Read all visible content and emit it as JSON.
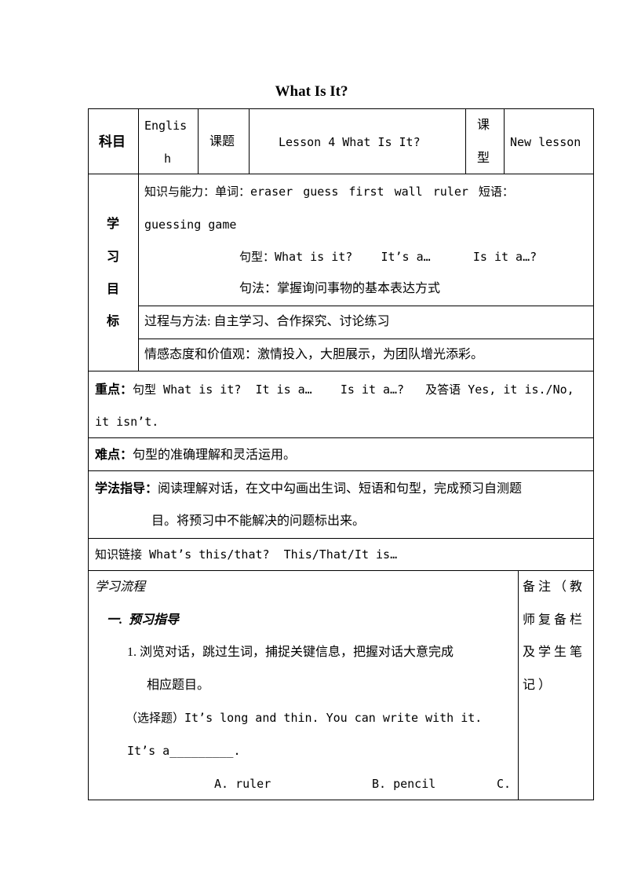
{
  "title": "What Is It?",
  "header_row": {
    "subject_label": "科目",
    "subject_value_line1": "Englis",
    "subject_value_line2": "h",
    "topic_label": "课题",
    "topic_value": "Lesson 4 What Is It?",
    "type_label_line1": "课",
    "type_label_line2": "型",
    "type_value": "New lesson"
  },
  "objectives": {
    "label_chars": [
      "学",
      "习",
      "目",
      "标"
    ],
    "knowledge_line1": "知识与能力：单词：eraser  guess  first  wall  ruler  短语：",
    "knowledge_line2": "guessing game",
    "sentence_pattern": "句型：What is it?    It’s a…      Is it a…?",
    "grammar": "句法：掌握询问事物的基本表达方式",
    "process": "过程与方法: 自主学习、合作探究、讨论练习",
    "emotion": "情感态度和价值观：激情投入，大胆展示，为团队增光添彩。"
  },
  "key_points": {
    "label": "重点：",
    "line1": "句型 What is it?  It is a…    Is it a…?   及答语 Yes, it is./No,",
    "line2": "it isn’t."
  },
  "difficulties": {
    "label": "难点：",
    "text": "句型的准确理解和灵活运用。"
  },
  "study_guide": {
    "label": "学法指导：",
    "line1": "阅读理解对话，在文中勾画出生词、短语和句型，完成预习自测题",
    "line2": "目。将预习中不能解决的问题标出来。"
  },
  "knowledge_link": "知识链接 What’s this/that?  This/That/It is…",
  "process": {
    "heading": "学习流程",
    "section1": "一.  预习指导",
    "item1_line1": "1. 浏览对话，跳过生词，捕捉关键信息，把握对话大意完成",
    "item1_line2": "相应题目。",
    "question_line1": "（选择题）It’s long and thin. You can write with it.",
    "question_line2": "It’s a_________.",
    "option_a": "A. ruler",
    "option_b": "B. pencil",
    "option_c": "C."
  },
  "remarks": {
    "lines": [
      "备注（教",
      "师复备栏",
      "及学生笔",
      "记）"
    ]
  }
}
